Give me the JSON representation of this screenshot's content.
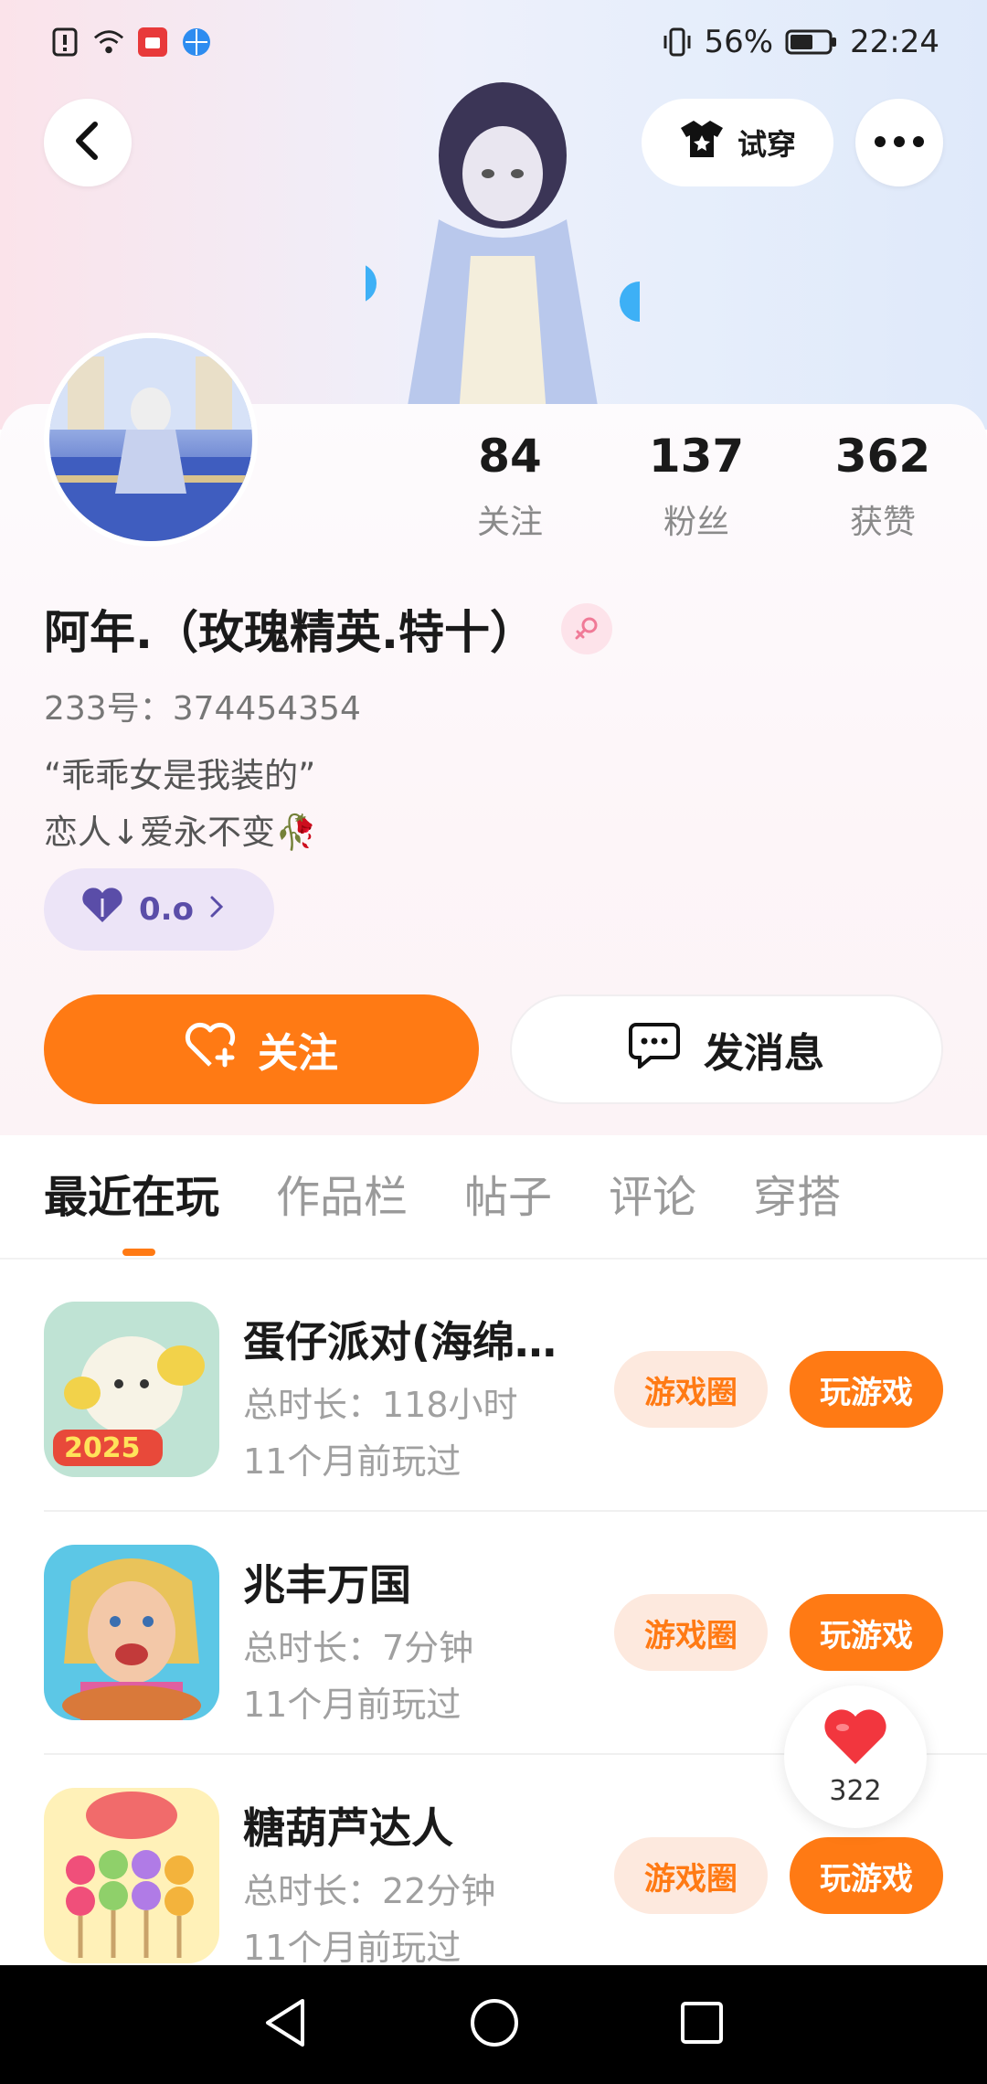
{
  "status_bar": {
    "battery_percent": "56%",
    "time": "22:24"
  },
  "header": {
    "back_icon": "back-arrow-icon",
    "try_on_label": "试穿",
    "more_icon": "more-dots-icon"
  },
  "profile": {
    "stats": [
      {
        "value": "84",
        "label": "关注"
      },
      {
        "value": "137",
        "label": "粉丝"
      },
      {
        "value": "362",
        "label": "获赞"
      }
    ],
    "username": "阿年.（玫瑰精英.特十）",
    "gender_icon": "female-icon",
    "id_text": "233号：374454354",
    "bio_line1": "“乖乖女是我装的”",
    "bio_line2": "恋人↓爱永不变🥀",
    "vip_value": "0.o"
  },
  "actions": {
    "follow_label": "关注",
    "message_label": "发消息"
  },
  "tabs": [
    "最近在玩",
    "作品栏",
    "帖子",
    "评论",
    "穿搭"
  ],
  "games": [
    {
      "name": "蛋仔派对(海绵宝宝联动)",
      "duration": "总时长：118小时",
      "last_played": "11个月前玩过",
      "circle_label": "游戏圈",
      "play_label": "玩游戏"
    },
    {
      "name": "兆丰万国",
      "duration": "总时长：7分钟",
      "last_played": "11个月前玩过",
      "circle_label": "游戏圈",
      "play_label": "玩游戏"
    },
    {
      "name": "糖葫芦达人",
      "duration": "总时长：22分钟",
      "last_played": "11个月前玩过",
      "circle_label": "游戏圈",
      "play_label": "玩游戏"
    }
  ],
  "like_float": {
    "count": "322"
  },
  "colors": {
    "accent": "#ff7a14",
    "accent_light": "#fde9de"
  }
}
